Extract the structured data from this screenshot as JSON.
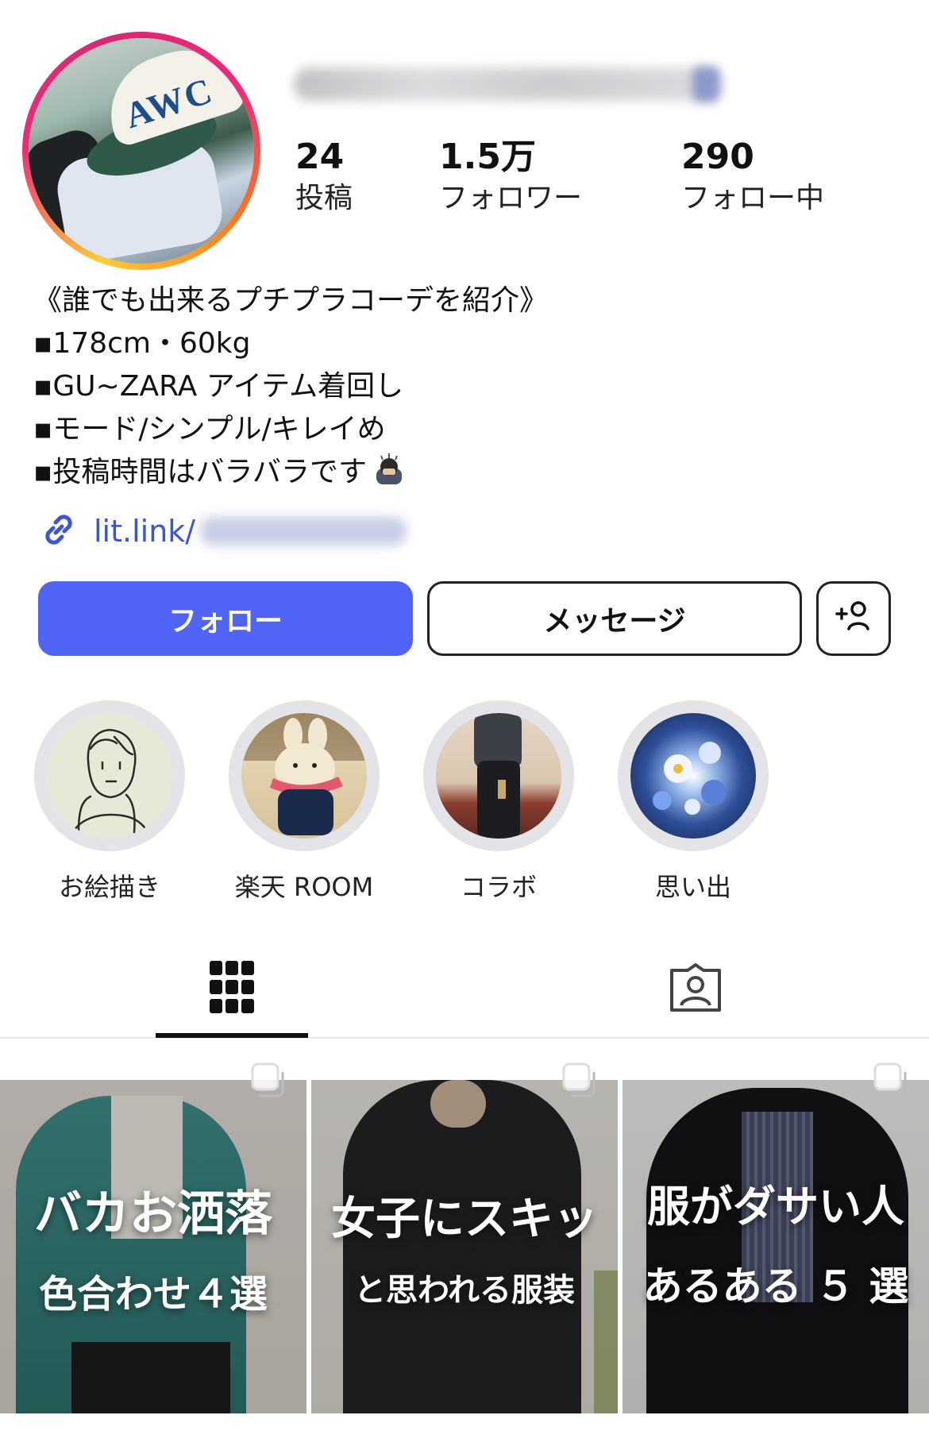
{
  "profile": {
    "stats": [
      {
        "value": "24",
        "label": "投稿"
      },
      {
        "value": "1.5万",
        "label": "フォロワー"
      },
      {
        "value": "290",
        "label": "フォロー中"
      }
    ],
    "bio_lines": [
      "《誰でも出来るプチプラコーデを紹介》",
      "▪178cm・60kg",
      "▪GU~ZARA アイテム着回し",
      "▪モード/シンプル/キレイめ",
      "▪投稿時間はバラバラです"
    ],
    "avatar_cap_text": "AWC",
    "link_prefix": "lit.link/"
  },
  "actions": {
    "follow_label": "フォロー",
    "message_label": "メッセージ"
  },
  "highlights": [
    {
      "label": "お絵描き"
    },
    {
      "label": "楽天 ROOM"
    },
    {
      "label": "コラボ"
    },
    {
      "label": "思い出"
    }
  ],
  "tabs": [
    {
      "icon": "grid-icon",
      "active": true
    },
    {
      "icon": "tagged-icon",
      "active": false
    }
  ],
  "posts": [
    {
      "title": "バカお洒落",
      "subtitle": "色合わせ４選"
    },
    {
      "title": "女子にスキッ",
      "subtitle": "と思われる服装"
    },
    {
      "title": "服がダサい人",
      "subtitle": "あるある ５ 選"
    }
  ],
  "colors": {
    "accent": "#5065f5",
    "link": "#3b55d6",
    "highlight_ring": "#e4e4e8"
  }
}
